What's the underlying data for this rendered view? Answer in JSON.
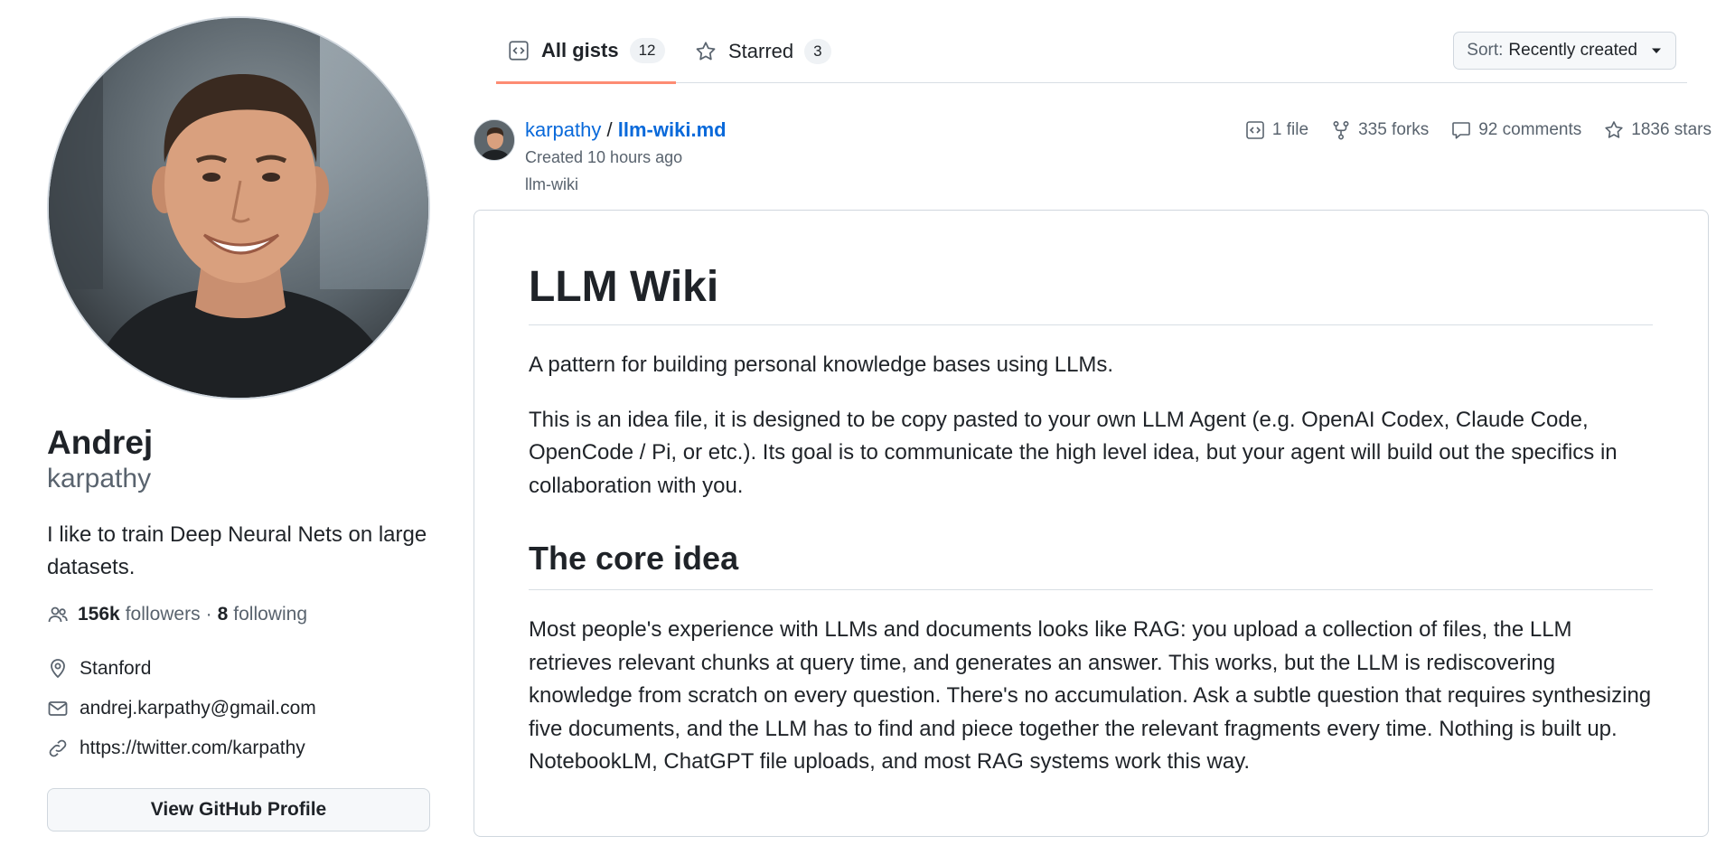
{
  "profile": {
    "name": "Andrej",
    "login": "karpathy",
    "bio": "I like to train Deep Neural Nets on large datasets.",
    "followers_count": "156k",
    "followers_label": "followers",
    "separator": "·",
    "following_count": "8",
    "following_label": "following",
    "location": "Stanford",
    "email": "andrej.karpathy@gmail.com",
    "website": "https://twitter.com/karpathy",
    "view_button_label": "View GitHub Profile"
  },
  "tabs": [
    {
      "label": "All gists",
      "count": "12",
      "selected": true
    },
    {
      "label": "Starred",
      "count": "3",
      "selected": false
    }
  ],
  "sort": {
    "label": "Sort:",
    "value": "Recently created"
  },
  "gist": {
    "owner": "karpathy",
    "separator": "/",
    "filename": "llm-wiki.md",
    "created": "Created 10 hours ago",
    "description": "llm-wiki",
    "files": "1 file",
    "forks": "335 forks",
    "comments": "92 comments",
    "stars": "1836 stars"
  },
  "content": {
    "h1": "LLM Wiki",
    "p1": "A pattern for building personal knowledge bases using LLMs.",
    "p2": "This is an idea file, it is designed to be copy pasted to your own LLM Agent (e.g. OpenAI Codex, Claude Code, OpenCode / Pi, or etc.). Its goal is to communicate the high level idea, but your agent will build out the specifics in collaboration with you.",
    "h2": "The core idea",
    "p3": "Most people's experience with LLMs and documents looks like RAG: you upload a collection of files, the LLM retrieves relevant chunks at query time, and generates an answer. This works, but the LLM is rediscovering knowledge from scratch on every question. There's no accumulation. Ask a subtle question that requires synthesizing five documents, and the LLM has to find and piece together the relevant fragments every time. Nothing is built up. NotebookLM, ChatGPT file uploads, and most RAG systems work this way."
  },
  "colors": {
    "link": "#0969da",
    "text": "#1f2328",
    "muted": "#59636e",
    "border": "#d0d7de",
    "tab_underline": "#fd8c73"
  },
  "icons": {
    "tab_all": "code-square-icon",
    "tab_starred": "star-icon",
    "followers": "people-icon",
    "location": "location-pin-icon",
    "email": "mail-icon",
    "website": "link-icon",
    "files": "code-square-icon",
    "forks": "fork-icon",
    "comments": "comment-icon",
    "stars": "star-icon",
    "sort": "caret-down-icon"
  }
}
